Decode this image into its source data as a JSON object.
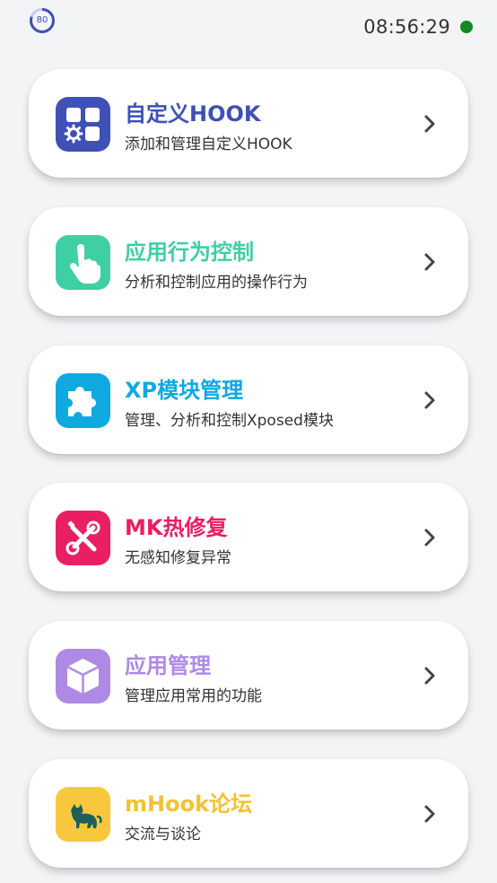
{
  "status": {
    "battery": "80",
    "time": "08:56:29",
    "online_color": "#118a1e"
  },
  "cards": [
    {
      "title": "自定义HOOK",
      "subtitle": "添加和管理自定义HOOK",
      "icon": "widgets-gear-icon",
      "color": "#3f51b5"
    },
    {
      "title": "应用行为控制",
      "subtitle": "分析和控制应用的操作行为",
      "icon": "hand-pointer-icon",
      "color": "#3fcfa4"
    },
    {
      "title": "XP模块管理",
      "subtitle": "管理、分析和控制Xposed模块",
      "icon": "puzzle-icon",
      "color": "#0fa9e0"
    },
    {
      "title": "MK热修复",
      "subtitle": "无感知修复异常",
      "icon": "wrench-screwdriver-icon",
      "color": "#e91e63"
    },
    {
      "title": "应用管理",
      "subtitle": "管理应用常用的功能",
      "icon": "cube-icon",
      "color": "#ae8ae4"
    },
    {
      "title": "mHook论坛",
      "subtitle": "交流与谈论",
      "icon": "cat-icon",
      "color": "#f7c83d"
    }
  ]
}
